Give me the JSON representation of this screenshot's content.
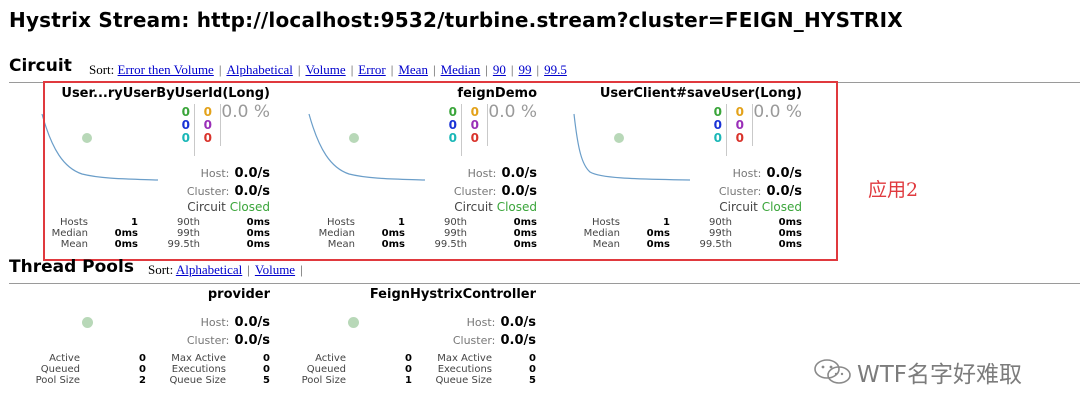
{
  "page_title": "Hystrix Stream: http://localhost:9532/turbine.stream?cluster=FEIGN_HYSTRIX",
  "circuit_section": {
    "title": "Circuit",
    "sort_label": "Sort:",
    "sort_links": [
      "Error then Volume",
      "Alphabetical",
      "Volume",
      "Error",
      "Mean",
      "Median",
      "90",
      "99",
      "99.5"
    ]
  },
  "pool_section": {
    "title": "Thread Pools",
    "sort_label": "Sort:",
    "sort_links": [
      "Alphabetical",
      "Volume"
    ],
    "trailing_sep": "|"
  },
  "sep": "|",
  "annotation": "应用2",
  "circuits": [
    {
      "name": "User...ryUserByUserId(Long)",
      "counts_left": [
        "0",
        "0",
        "0"
      ],
      "counts_right": [
        "0",
        "0",
        "0"
      ],
      "error_rate": "0.0 %",
      "host_label": "Host:",
      "host_value": "0.0/s",
      "cluster_label": "Cluster:",
      "cluster_value": "0.0/s",
      "circuit_label": "Circuit",
      "circuit_state": "Closed",
      "stats": [
        [
          "Hosts",
          "1",
          "90th",
          "0ms"
        ],
        [
          "Median",
          "0ms",
          "99th",
          "0ms"
        ],
        [
          "Mean",
          "0ms",
          "99.5th",
          "0ms"
        ]
      ]
    },
    {
      "name": "feignDemo",
      "counts_left": [
        "0",
        "0",
        "0"
      ],
      "counts_right": [
        "0",
        "0",
        "0"
      ],
      "error_rate": "0.0 %",
      "host_label": "Host:",
      "host_value": "0.0/s",
      "cluster_label": "Cluster:",
      "cluster_value": "0.0/s",
      "circuit_label": "Circuit",
      "circuit_state": "Closed",
      "stats": [
        [
          "Hosts",
          "1",
          "90th",
          "0ms"
        ],
        [
          "Median",
          "0ms",
          "99th",
          "0ms"
        ],
        [
          "Mean",
          "0ms",
          "99.5th",
          "0ms"
        ]
      ]
    },
    {
      "name": "UserClient#saveUser(Long)",
      "counts_left": [
        "0",
        "0",
        "0"
      ],
      "counts_right": [
        "0",
        "0",
        "0"
      ],
      "error_rate": "0.0 %",
      "host_label": "Host:",
      "host_value": "0.0/s",
      "cluster_label": "Cluster:",
      "cluster_value": "0.0/s",
      "circuit_label": "Circuit",
      "circuit_state": "Closed",
      "stats": [
        [
          "Hosts",
          "1",
          "90th",
          "0ms"
        ],
        [
          "Median",
          "0ms",
          "99th",
          "0ms"
        ],
        [
          "Mean",
          "0ms",
          "99.5th",
          "0ms"
        ]
      ]
    }
  ],
  "pools": [
    {
      "name": "provider",
      "host_label": "Host:",
      "host_value": "0.0/s",
      "cluster_label": "Cluster:",
      "cluster_value": "0.0/s",
      "stats": [
        [
          "Active",
          "0",
          "Max Active",
          "0"
        ],
        [
          "Queued",
          "0",
          "Executions",
          "0"
        ],
        [
          "Pool Size",
          "2",
          "Queue Size",
          "5"
        ]
      ]
    },
    {
      "name": "FeignHystrixController",
      "host_label": "Host:",
      "host_value": "0.0/s",
      "cluster_label": "Cluster:",
      "cluster_value": "0.0/s",
      "stats": [
        [
          "Active",
          "0",
          "Max Active",
          "0"
        ],
        [
          "Queued",
          "0",
          "Executions",
          "0"
        ],
        [
          "Pool Size",
          "1",
          "Queue Size",
          "5"
        ]
      ]
    }
  ],
  "watermark": "WTF名字好难取",
  "colors": {
    "count_success": "#3aa53a",
    "count_shortcircuit": "#1a33d6",
    "count_badrequest": "#1ab7b7",
    "count_timeout": "#e3a21a",
    "count_rejected": "#9a2fb8",
    "count_failure": "#d9332b",
    "circuit_closed": "#3aa53a",
    "highlight": "#e0393e",
    "link": "#0000cc"
  }
}
